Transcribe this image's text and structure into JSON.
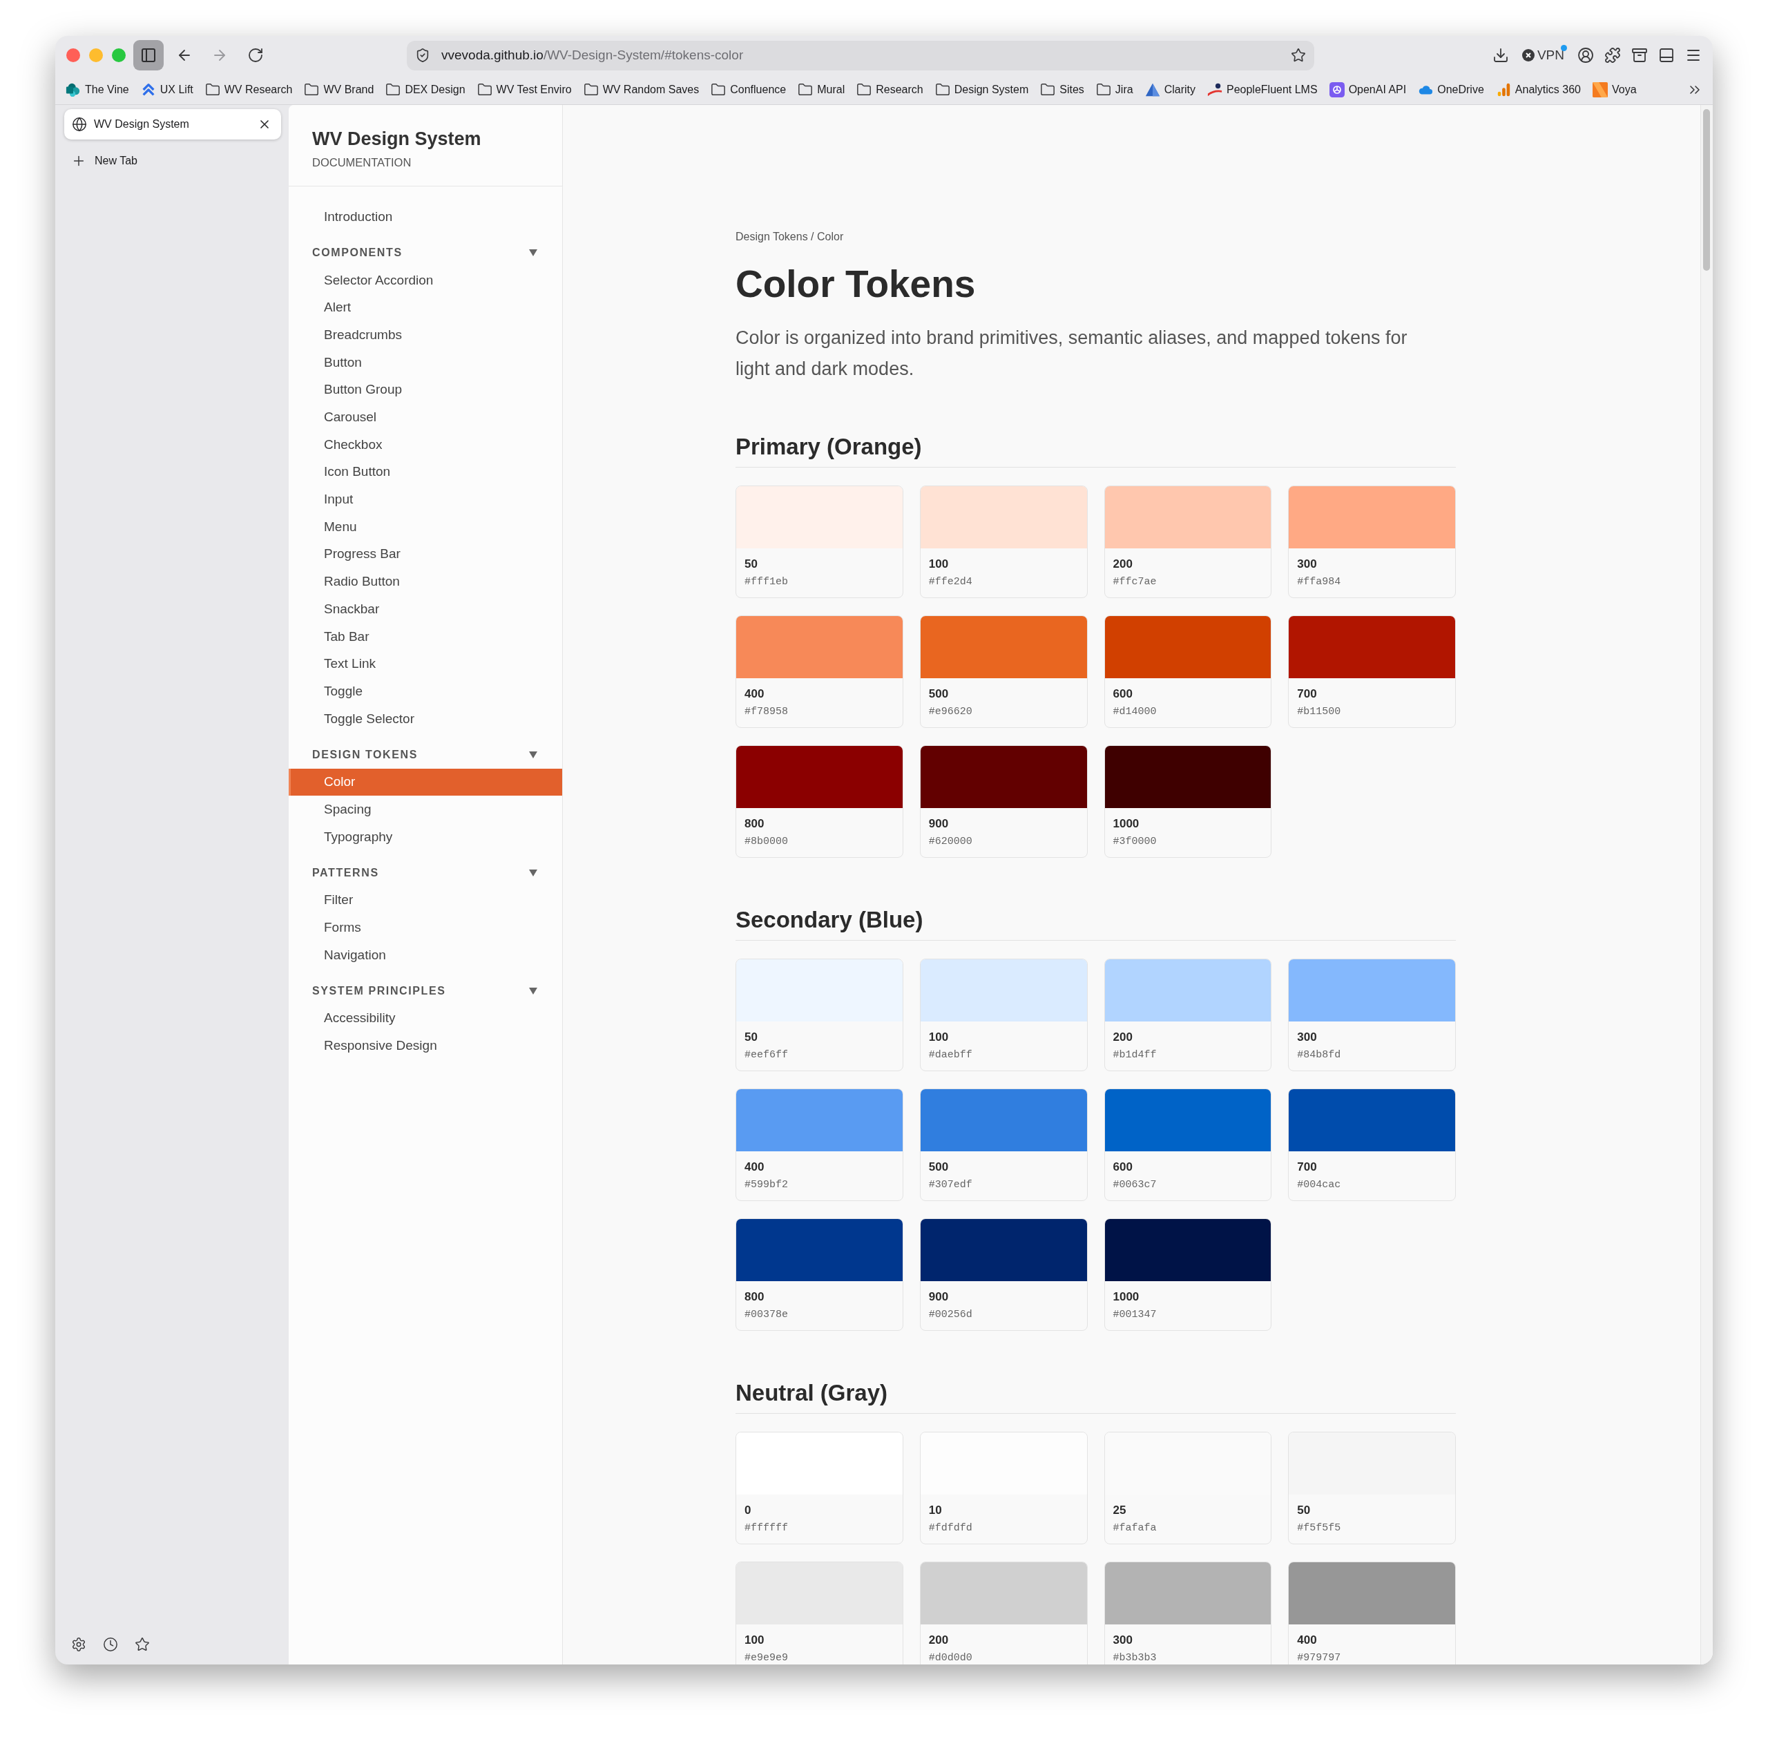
{
  "toolbar": {
    "url_host": "vvevoda.github.io",
    "url_path": "/WV-Design-System/#tokens-color",
    "vpn": "VPN"
  },
  "bookmarks": [
    {
      "label": "The Vine",
      "kind": "site"
    },
    {
      "label": "UX Lift",
      "kind": "site"
    },
    {
      "label": "WV Research",
      "kind": "folder"
    },
    {
      "label": "WV Brand",
      "kind": "folder"
    },
    {
      "label": "DEX Design",
      "kind": "folder"
    },
    {
      "label": "WV Test Enviro",
      "kind": "folder"
    },
    {
      "label": "WV Random Saves",
      "kind": "folder"
    },
    {
      "label": "Confluence",
      "kind": "folder"
    },
    {
      "label": "Mural",
      "kind": "folder"
    },
    {
      "label": "Research",
      "kind": "folder"
    },
    {
      "label": "Design System",
      "kind": "folder"
    },
    {
      "label": "Sites",
      "kind": "folder"
    },
    {
      "label": "Jira",
      "kind": "folder"
    },
    {
      "label": "Clarity",
      "kind": "site"
    },
    {
      "label": "PeopleFluent LMS",
      "kind": "site"
    },
    {
      "label": "OpenAI API",
      "kind": "site"
    },
    {
      "label": "OneDrive",
      "kind": "site"
    },
    {
      "label": "Analytics 360",
      "kind": "site"
    },
    {
      "label": "Voya",
      "kind": "site"
    }
  ],
  "tabs": [
    {
      "title": "WV Design System",
      "selected": true
    }
  ],
  "new_tab": "New Tab",
  "sidebar": {
    "title": "WV Design System",
    "subtitle": "DOCUMENTATION",
    "items": [
      {
        "label": "Introduction",
        "selected": false
      }
    ],
    "sections": [
      {
        "heading": "COMPONENTS",
        "expanded": true,
        "items": [
          {
            "label": "Selector Accordion",
            "selected": false
          },
          {
            "label": "Alert",
            "selected": false
          },
          {
            "label": "Breadcrumbs",
            "selected": false
          },
          {
            "label": "Button",
            "selected": false
          },
          {
            "label": "Button Group",
            "selected": false
          },
          {
            "label": "Carousel",
            "selected": false
          },
          {
            "label": "Checkbox",
            "selected": false
          },
          {
            "label": "Icon Button",
            "selected": false
          },
          {
            "label": "Input",
            "selected": false
          },
          {
            "label": "Menu",
            "selected": false
          },
          {
            "label": "Progress Bar",
            "selected": false
          },
          {
            "label": "Radio Button",
            "selected": false
          },
          {
            "label": "Snackbar",
            "selected": false
          },
          {
            "label": "Tab Bar",
            "selected": false
          },
          {
            "label": "Text Link",
            "selected": false
          },
          {
            "label": "Toggle",
            "selected": false
          },
          {
            "label": "Toggle Selector",
            "selected": false
          }
        ]
      },
      {
        "heading": "DESIGN TOKENS",
        "expanded": true,
        "items": [
          {
            "label": "Color",
            "selected": true
          },
          {
            "label": "Spacing",
            "selected": false
          },
          {
            "label": "Typography",
            "selected": false
          }
        ]
      },
      {
        "heading": "PATTERNS",
        "expanded": true,
        "items": [
          {
            "label": "Filter",
            "selected": false
          },
          {
            "label": "Forms",
            "selected": false
          },
          {
            "label": "Navigation",
            "selected": false
          }
        ]
      },
      {
        "heading": "SYSTEM PRINCIPLES",
        "expanded": true,
        "items": [
          {
            "label": "Accessibility",
            "selected": false
          },
          {
            "label": "Responsive Design",
            "selected": false
          }
        ]
      }
    ]
  },
  "page": {
    "breadcrumb": "Design Tokens / Color",
    "title": "Color Tokens",
    "description": "Color is organized into brand primitives, semantic aliases, and mapped tokens for light and dark modes.",
    "palettes": [
      {
        "heading": "Primary (Orange)",
        "swatches": [
          {
            "step": "50",
            "hex": "#fff1eb",
            "color": "#fff1eb"
          },
          {
            "step": "100",
            "hex": "#ffe2d4",
            "color": "#ffe2d4"
          },
          {
            "step": "200",
            "hex": "#ffc7ae",
            "color": "#ffc7ae"
          },
          {
            "step": "300",
            "hex": "#ffa984",
            "color": "#ffa984"
          },
          {
            "step": "400",
            "hex": "#f78958",
            "color": "#f78958"
          },
          {
            "step": "500",
            "hex": "#e96620",
            "color": "#e96620"
          },
          {
            "step": "600",
            "hex": "#d14000",
            "color": "#d14000"
          },
          {
            "step": "700",
            "hex": "#b11500",
            "color": "#b11500"
          },
          {
            "step": "800",
            "hex": "#8b0000",
            "color": "#8b0000"
          },
          {
            "step": "900",
            "hex": "#620000",
            "color": "#620000"
          },
          {
            "step": "1000",
            "hex": "#3f0000",
            "color": "#3f0000"
          }
        ]
      },
      {
        "heading": "Secondary (Blue)",
        "swatches": [
          {
            "step": "50",
            "hex": "#eef6ff",
            "color": "#eef6ff"
          },
          {
            "step": "100",
            "hex": "#daebff",
            "color": "#daebff"
          },
          {
            "step": "200",
            "hex": "#b1d4ff",
            "color": "#b1d4ff"
          },
          {
            "step": "300",
            "hex": "#84b8fd",
            "color": "#84b8fd"
          },
          {
            "step": "400",
            "hex": "#599bf2",
            "color": "#599bf2"
          },
          {
            "step": "500",
            "hex": "#307edf",
            "color": "#307edf"
          },
          {
            "step": "600",
            "hex": "#0063c7",
            "color": "#0063c7"
          },
          {
            "step": "700",
            "hex": "#004cac",
            "color": "#004cac"
          },
          {
            "step": "800",
            "hex": "#00378e",
            "color": "#00378e"
          },
          {
            "step": "900",
            "hex": "#00256d",
            "color": "#00256d"
          },
          {
            "step": "1000",
            "hex": "#001347",
            "color": "#001347"
          }
        ]
      },
      {
        "heading": "Neutral (Gray)",
        "swatches": [
          {
            "step": "0",
            "hex": "#ffffff",
            "color": "#ffffff"
          },
          {
            "step": "10",
            "hex": "#fdfdfd",
            "color": "#fdfdfd"
          },
          {
            "step": "25",
            "hex": "#fafafa",
            "color": "#fafafa"
          },
          {
            "step": "50",
            "hex": "#f5f5f5",
            "color": "#f5f5f5"
          },
          {
            "step": "100",
            "hex": "#e9e9e9",
            "color": "#e9e9e9"
          },
          {
            "step": "200",
            "hex": "#d0d0d0",
            "color": "#d0d0d0"
          },
          {
            "step": "300",
            "hex": "#b3b3b3",
            "color": "#b3b3b3"
          },
          {
            "step": "400",
            "hex": "#979797",
            "color": "#979797"
          }
        ]
      }
    ]
  }
}
